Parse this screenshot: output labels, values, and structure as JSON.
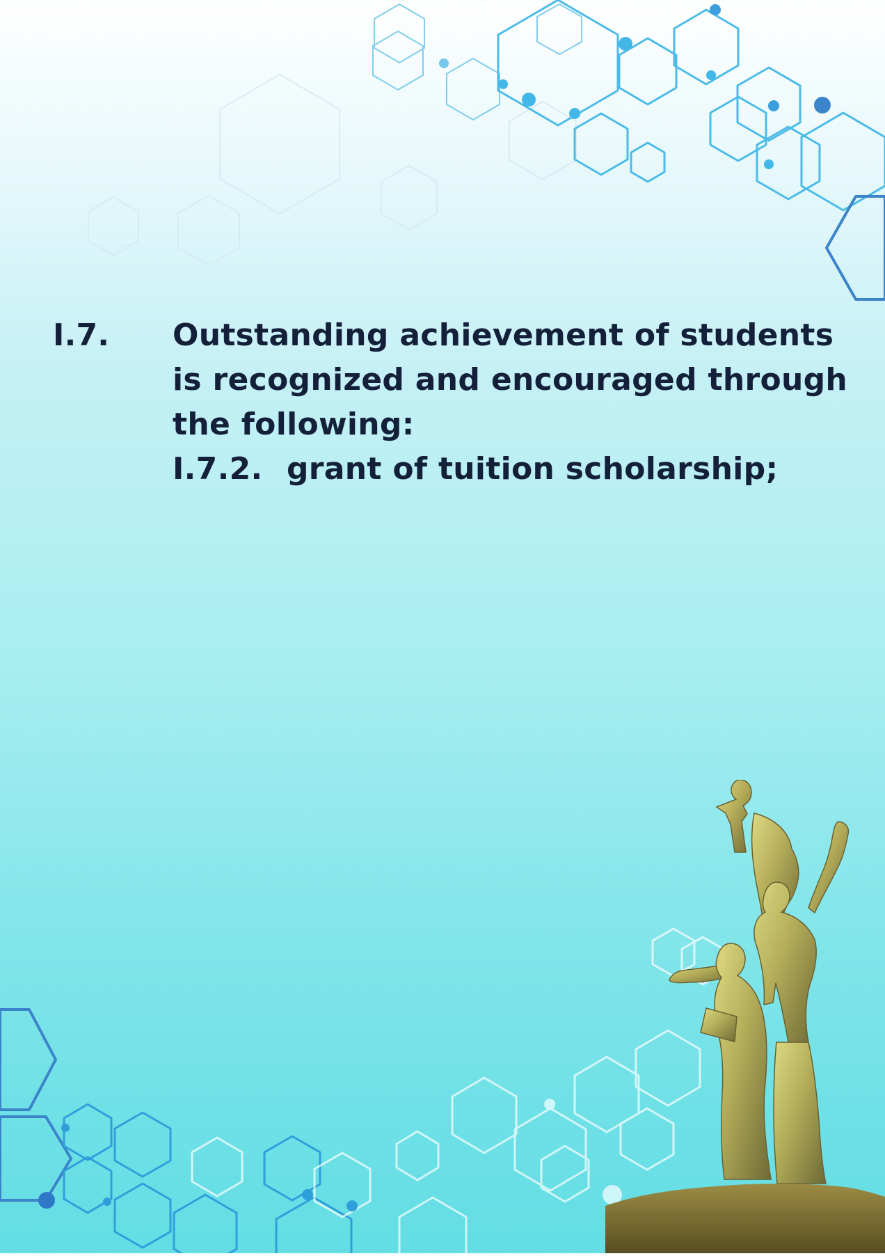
{
  "section": {
    "number": "I.7.",
    "text": "Outstanding achievement of students is recognized and encouraged through the following:",
    "subitems": [
      {
        "number": "I.7.2.",
        "text": "grant of tuition scholarship;"
      }
    ]
  },
  "decorations": {
    "hexagon_color_dark": "#2f78c7",
    "hexagon_color_light": "#43b8e8",
    "hexagon_color_faded": "#b8dff0",
    "statue_color": "#b7aa52"
  }
}
